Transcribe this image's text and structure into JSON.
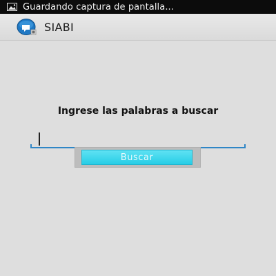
{
  "status_bar": {
    "notification_icon": "image-icon",
    "text": "Guardando captura de pantalla..."
  },
  "action_bar": {
    "app_icon": "app-logo-icon",
    "title": "SIABI"
  },
  "main": {
    "prompt": "Ingrese las palabras a buscar",
    "search_input": {
      "value": "",
      "placeholder": ""
    },
    "search_button_label": "Buscar"
  },
  "colors": {
    "accent": "#2f86c6",
    "button": "#27cde6",
    "status_bar": "#0c0c0c"
  }
}
